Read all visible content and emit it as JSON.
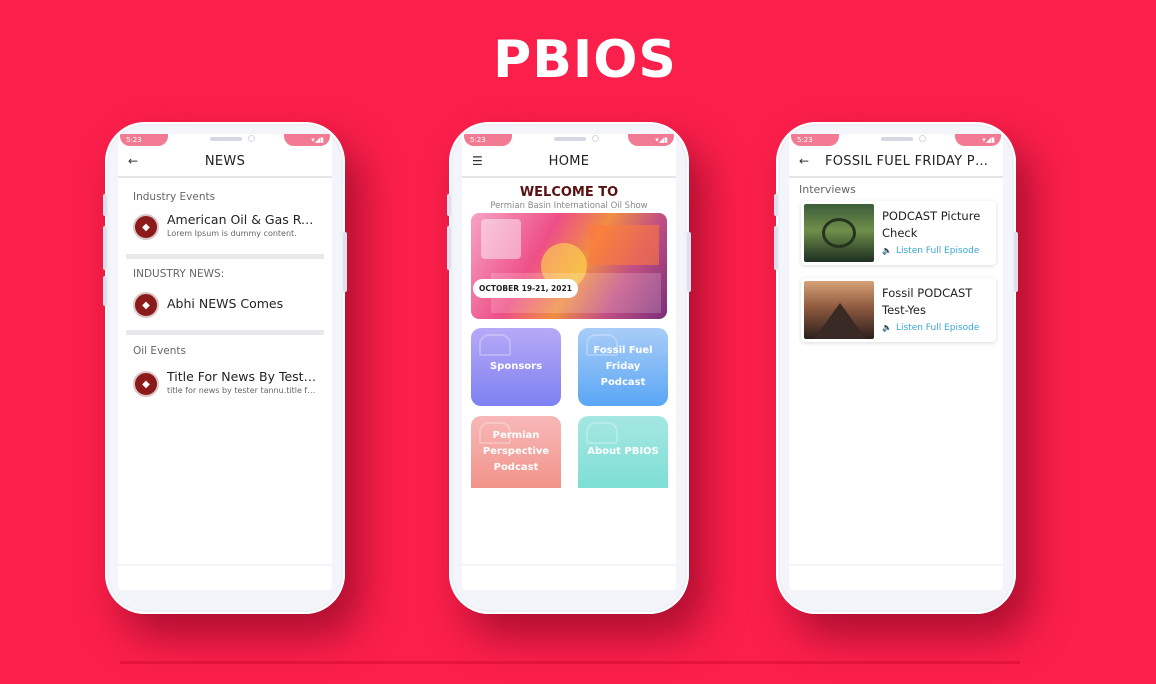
{
  "brand": {
    "title": "PBIOS"
  },
  "colors": {
    "background": "#fb1f4b",
    "accent_link": "#3aa6d8"
  },
  "status_bar": {
    "time": "5:23"
  },
  "news_screen": {
    "title": "NEWS",
    "back_icon": "arrow-left-icon",
    "sections": [
      {
        "heading": "Industry Events",
        "items": [
          {
            "title": "American Oil & Gas Re...",
            "subtitle": "Lorem Ipsum is dummy content."
          }
        ]
      },
      {
        "heading": "INDUSTRY NEWS:",
        "items": [
          {
            "title": "Abhi NEWS Comes",
            "subtitle": ""
          }
        ]
      },
      {
        "heading": "Oil Events",
        "items": [
          {
            "title": "Title For News By Teste...",
            "subtitle": "title for news by tester tannu.title fo..."
          }
        ]
      }
    ]
  },
  "home_screen": {
    "title": "HOME",
    "menu_icon": "hamburger-menu-icon",
    "welcome_title": "WELCOME TO",
    "welcome_subtitle": "Permian Basin International Oil Show",
    "banner_date": "OCTOBER 19-21, 2021",
    "tiles": [
      {
        "label": "Sponsors"
      },
      {
        "label": "Fossil Fuel Friday Podcast"
      },
      {
        "label": "Permian Perspective Podcast"
      },
      {
        "label": "About PBIOS"
      }
    ]
  },
  "podcast_screen": {
    "title": "FOSSIL FUEL FRIDAY PO...",
    "back_icon": "arrow-left-icon",
    "section": "Interviews",
    "episodes": [
      {
        "title": "PODCAST Picture Check",
        "listen_label": "Listen Full Episode"
      },
      {
        "title": "Fossil PODCAST Test-Yes",
        "listen_label": "Listen Full Episode"
      }
    ]
  }
}
